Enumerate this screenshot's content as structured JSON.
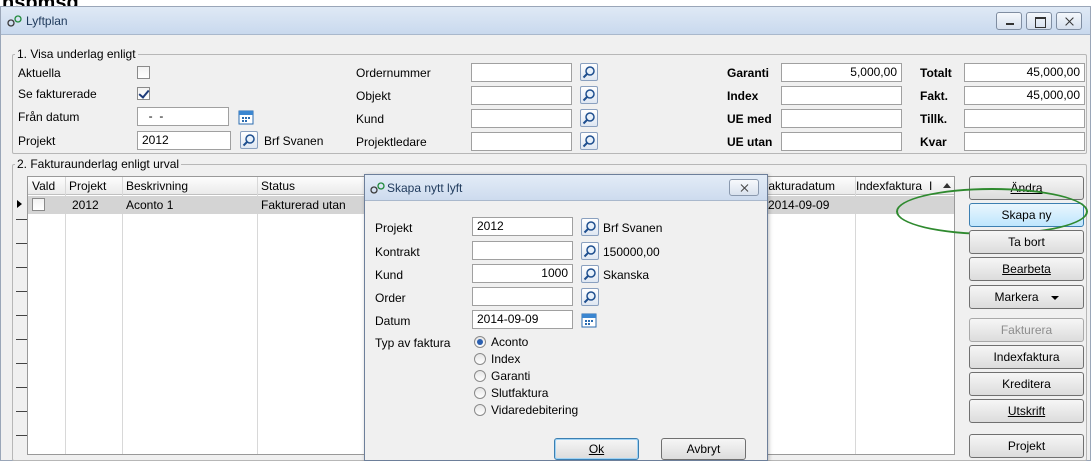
{
  "window": {
    "title": "Lyftplan"
  },
  "section1": {
    "legend": "1. Visa underlag enligt",
    "aktuella": {
      "label": "Aktuella",
      "checked": false
    },
    "se_fakturerade": {
      "label": "Se fakturerade",
      "checked": true
    },
    "fran_datum": {
      "label": "Från datum",
      "value": "  -  -"
    },
    "projekt": {
      "label": "Projekt",
      "value": "2012",
      "name": "Brf Svanen"
    },
    "ordernummer": {
      "label": "Ordernummer",
      "value": ""
    },
    "objekt": {
      "label": "Objekt",
      "value": ""
    },
    "kund": {
      "label": "Kund",
      "value": ""
    },
    "projektledare": {
      "label": "Projektledare",
      "value": ""
    },
    "garanti": {
      "label": "Garanti",
      "value": "5,000,00"
    },
    "index": {
      "label": "Index",
      "value": ""
    },
    "ue_med": {
      "label": "UE med",
      "value": ""
    },
    "ue_utan": {
      "label": "UE utan",
      "value": ""
    },
    "totalt": {
      "label": "Totalt",
      "value": "45,000,00"
    },
    "fakt": {
      "label": "Fakt.",
      "value": "45,000,00"
    },
    "tillk": {
      "label": "Tillk.",
      "value": ""
    },
    "kvar": {
      "label": "Kvar",
      "value": ""
    }
  },
  "section2": {
    "legend": "2. Fakturaunderlag enligt urval",
    "columns": [
      "Vald",
      "Projekt",
      "Beskrivning",
      "Status",
      "Fakturadatum",
      "Indexfaktura",
      "I"
    ],
    "rows": [
      {
        "vald": false,
        "projekt": "2012",
        "beskrivning": "Aconto 1",
        "status": "Fakturerad utan",
        "fakturadatum": "2014-09-09",
        "indexfaktura": ""
      }
    ]
  },
  "buttons": {
    "andra": "Ändra",
    "skapa_ny": "Skapa ny",
    "ta_bort": "Ta bort",
    "bearbeta": "Bearbeta",
    "markera": "Markera",
    "fakturera": "Fakturera",
    "indexfaktura": "Indexfaktura",
    "kreditera": "Kreditera",
    "utskrift": "Utskrift",
    "projekt": "Projekt"
  },
  "dialog": {
    "title": "Skapa nytt lyft",
    "projekt": {
      "label": "Projekt",
      "value": "2012",
      "name": "Brf Svanen"
    },
    "kontrakt": {
      "label": "Kontrakt",
      "value": "",
      "amount": "150000,00"
    },
    "kund": {
      "label": "Kund",
      "value": "1000",
      "name": "Skanska"
    },
    "order": {
      "label": "Order",
      "value": ""
    },
    "datum": {
      "label": "Datum",
      "value": "2014-09-09"
    },
    "typ_label": "Typ av faktura",
    "options": [
      "Aconto",
      "Index",
      "Garanti",
      "Slutfaktura",
      "Vidaredebitering"
    ],
    "selected": "Aconto",
    "ok": "Ok",
    "avbryt": "Avbryt"
  },
  "overlay_text": "nspmsg"
}
